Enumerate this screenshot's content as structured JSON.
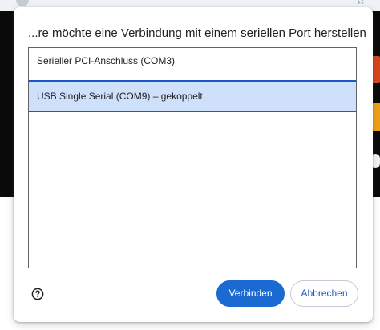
{
  "dialog": {
    "title": "...re möchte eine Verbindung mit einem seriellen Port herstellen",
    "ports": [
      {
        "label": "Serieller PCI-Anschluss (COM3)",
        "selected": false
      },
      {
        "label": "USB Single Serial (COM9) – gekoppelt",
        "selected": true
      }
    ],
    "help_icon": "help-circle-icon",
    "connect_label": "Verbinden",
    "cancel_label": "Abbrechen"
  },
  "colors": {
    "accent": "#1a6ad1",
    "selection_background": "#cfe0fb",
    "selection_border": "#1a57c8"
  }
}
